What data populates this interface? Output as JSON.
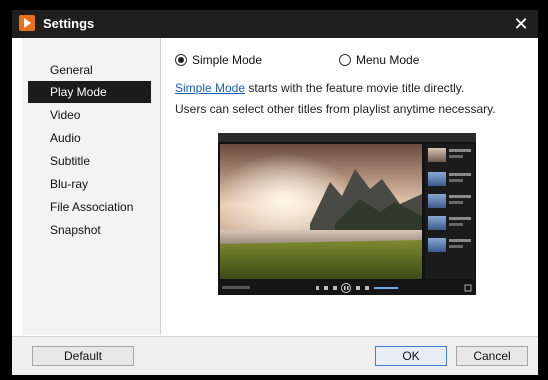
{
  "window": {
    "title": "Settings",
    "close_glyph": "✕",
    "accent_color": "#e8701a"
  },
  "sidebar": {
    "items": [
      {
        "label": "General",
        "active": false
      },
      {
        "label": "Play Mode",
        "active": true
      },
      {
        "label": "Video",
        "active": false
      },
      {
        "label": "Audio",
        "active": false
      },
      {
        "label": "Subtitle",
        "active": false
      },
      {
        "label": "Blu-ray",
        "active": false
      },
      {
        "label": "File Association",
        "active": false
      },
      {
        "label": "Snapshot",
        "active": false
      }
    ]
  },
  "play_mode": {
    "simple_mode_label": "Simple Mode",
    "menu_mode_label": "Menu Mode",
    "selected": "Simple Mode",
    "desc_link": "Simple Mode",
    "desc_line1_rest": " starts with the feature movie title directly.",
    "desc_line2": "Users can select other titles from playlist anytime necessary."
  },
  "footer": {
    "default_label": "Default",
    "ok_label": "OK",
    "cancel_label": "Cancel"
  }
}
